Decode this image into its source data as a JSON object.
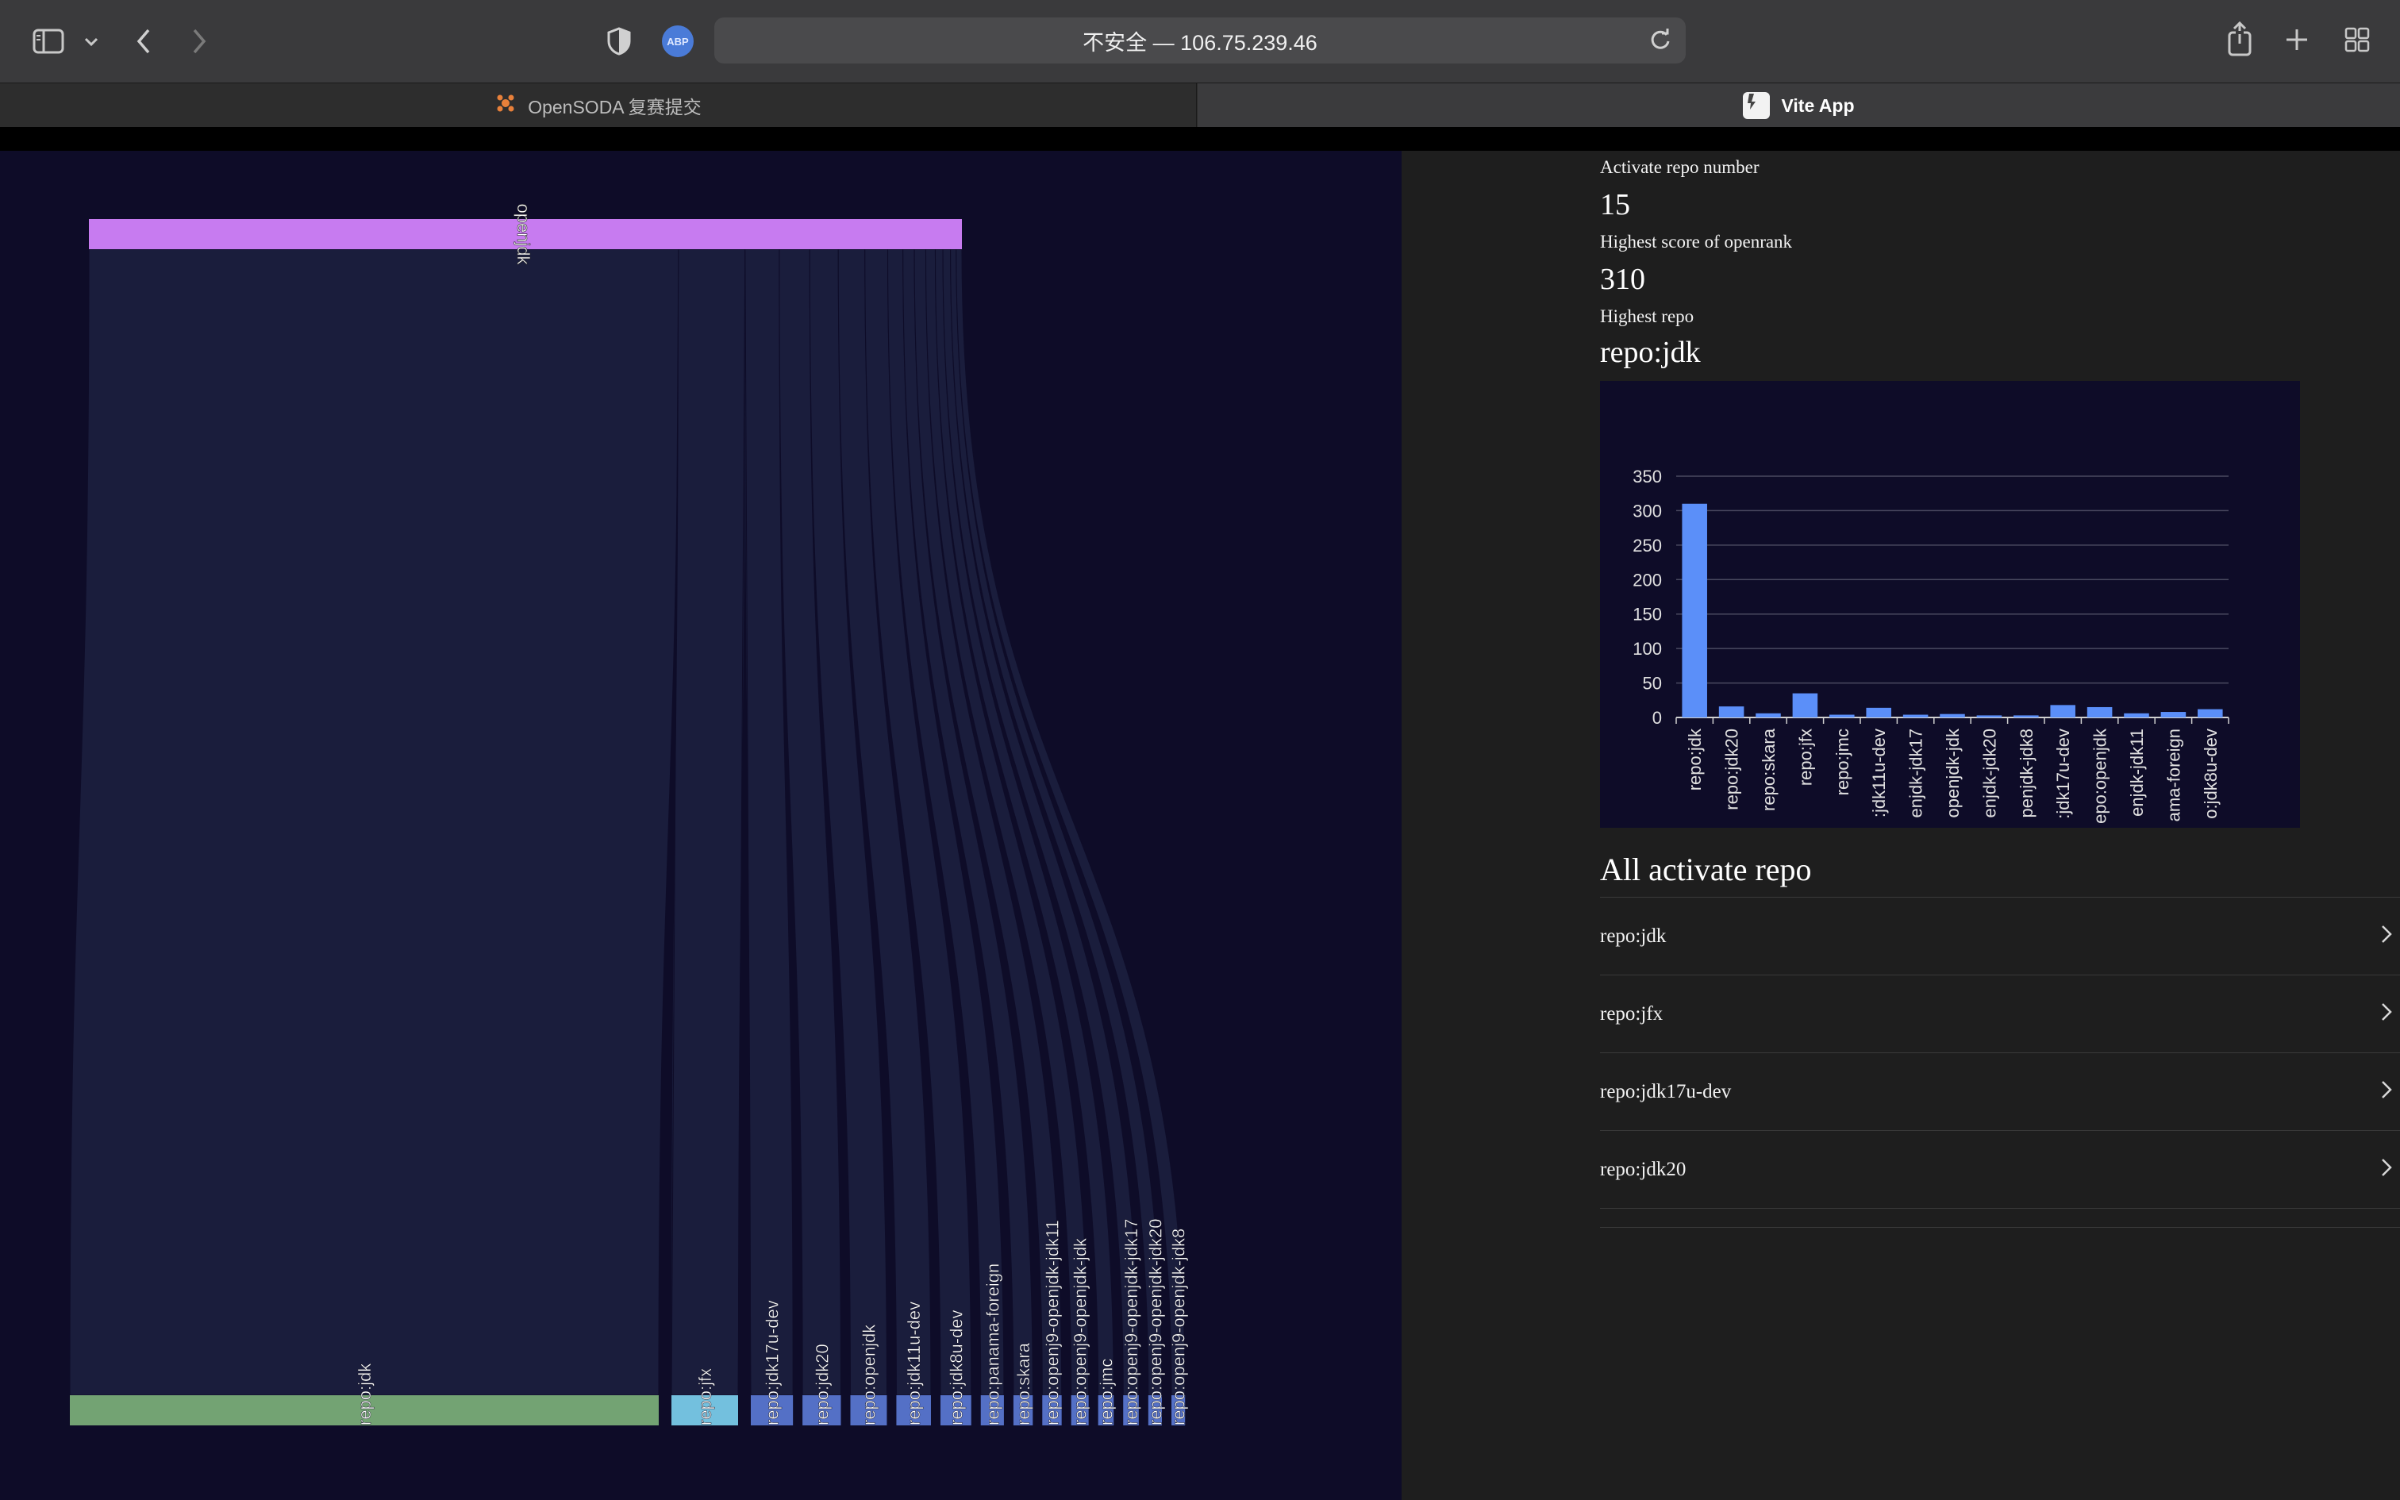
{
  "browser": {
    "url_text": "不安全 — 106.75.239.46",
    "abp_label": "ABP",
    "tabs": [
      {
        "label": "OpenSODA 复赛提交"
      },
      {
        "label": "Vite App"
      }
    ]
  },
  "sankey": {
    "source": "openjdk",
    "source_color": "#c77bf0",
    "targets": [
      {
        "label": "repo:jdk",
        "value": 310,
        "color": "#73a373"
      },
      {
        "label": "repo:jfx",
        "value": 35,
        "color": "#73c0de"
      },
      {
        "label": "repo:jdk17u-dev",
        "value": 18,
        "color": "#5470c6"
      },
      {
        "label": "repo:jdk20",
        "value": 16,
        "color": "#5470c6"
      },
      {
        "label": "repo:openjdk",
        "value": 15,
        "color": "#5470c6"
      },
      {
        "label": "repo:jdk11u-dev",
        "value": 14,
        "color": "#5470c6"
      },
      {
        "label": "repo:jdk8u-dev",
        "value": 12,
        "color": "#5470c6"
      },
      {
        "label": "repo:panama-foreign",
        "value": 8,
        "color": "#5470c6"
      },
      {
        "label": "repo:skara",
        "value": 6,
        "color": "#5470c6"
      },
      {
        "label": "repo:openj9-openjdk-jdk11",
        "value": 6,
        "color": "#5470c6"
      },
      {
        "label": "repo:openj9-openjdk-jdk",
        "value": 5,
        "color": "#5470c6"
      },
      {
        "label": "repo:jmc",
        "value": 4,
        "color": "#5470c6"
      },
      {
        "label": "repo:openj9-openjdk-jdk17",
        "value": 4,
        "color": "#5470c6"
      },
      {
        "label": "repo:openj9-openjdk-jdk20",
        "value": 3,
        "color": "#5470c6"
      },
      {
        "label": "repo:openj9-openjdk-jdk8",
        "value": 3,
        "color": "#5470c6"
      }
    ]
  },
  "stats": {
    "active_label": "Activate repo number",
    "active_value": "15",
    "highest_score_label": "Highest score of openrank",
    "highest_score_value": "310",
    "highest_repo_label": "Highest repo",
    "highest_repo_value": "repo:jdk"
  },
  "chart_data": {
    "type": "bar",
    "categories": [
      "repo:jdk",
      "repo:jdk20",
      "repo:skara",
      "repo:jfx",
      "repo:jmc",
      "repo:jdk11u-dev",
      "repo:openj9-openjdk-jdk17",
      "repo:openj9-openjdk-jdk",
      "repo:openj9-openjdk-jdk20",
      "repo:openj9-openjdk-jdk8",
      "repo:jdk17u-dev",
      "repo:openjdk",
      "repo:openj9-openjdk-jdk11",
      "repo:panama-foreign",
      "repo:jdk8u-dev"
    ],
    "visible_tick_labels": [
      "repo:jdk",
      "repo:jdk20",
      "repo:skara",
      "repo:jfx",
      "repo:jmc",
      ":jdk11u-dev",
      "enjdk-jdk17",
      "openjdk-jdk",
      "enjdk-jdk20",
      "penjdk-jdk8",
      ":jdk17u-dev",
      "epo:openjdk",
      "enjdk-jdk11",
      "ama-foreign",
      "o:jdk8u-dev"
    ],
    "values": [
      310,
      16,
      6,
      35,
      4,
      14,
      4,
      5,
      3,
      3,
      18,
      15,
      6,
      8,
      12
    ],
    "ylim": [
      0,
      350
    ],
    "yticks": [
      "0",
      "50",
      "100",
      "150",
      "200",
      "250",
      "300",
      "350"
    ],
    "bar_color": "#5b8ff9",
    "grid": true
  },
  "list": {
    "title": "All activate repo",
    "items": [
      "repo:jdk",
      "repo:jfx",
      "repo:jdk17u-dev",
      "repo:jdk20"
    ]
  }
}
